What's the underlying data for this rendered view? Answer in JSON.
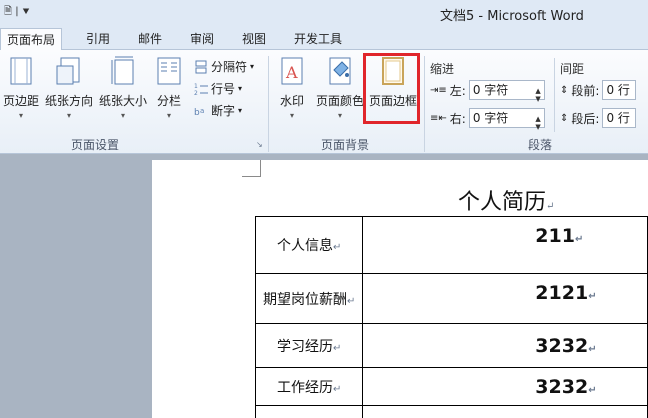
{
  "window": {
    "quick_access": "🗎 | ⯆",
    "title": "文档5 - Microsoft Word"
  },
  "tabs": [
    {
      "label": "页面布局",
      "active": true
    },
    {
      "label": "引用"
    },
    {
      "label": "邮件"
    },
    {
      "label": "审阅"
    },
    {
      "label": "视图"
    },
    {
      "label": "开发工具"
    }
  ],
  "ribbon": {
    "page_setup": {
      "group_label": "页面设置",
      "margins": "页边距",
      "orientation": "纸张方向",
      "size": "纸张大小",
      "columns": "分栏",
      "breaks": "分隔符",
      "line_numbers": "行号",
      "hyphenation": "断字"
    },
    "page_background": {
      "group_label": "页面背景",
      "watermark": "水印",
      "page_color": "页面颜色",
      "page_borders": "页面边框"
    },
    "paragraph": {
      "group_label": "段落",
      "indent_title": "缩进",
      "indent_left_label": "左:",
      "indent_left_value": "0 字符",
      "indent_right_label": "右:",
      "indent_right_value": "0 字符",
      "spacing_title": "间距",
      "spacing_before_label": "段前:",
      "spacing_before_value": "0 行",
      "spacing_after_label": "段后:",
      "spacing_after_value": "0 行"
    }
  },
  "document": {
    "title": "个人简历",
    "paragraph_mark": "↵",
    "rows": [
      {
        "label": "个人信息",
        "value": "211"
      },
      {
        "label": "期望岗位薪酬",
        "value": "2121"
      },
      {
        "label": "学习经历",
        "value": "3232"
      },
      {
        "label": "工作经历",
        "value": "3232"
      }
    ]
  },
  "colors": {
    "highlight": "#e0252b",
    "ribbon_bg": "#fbfcfe",
    "tab_bg": "#dfe9f5"
  }
}
